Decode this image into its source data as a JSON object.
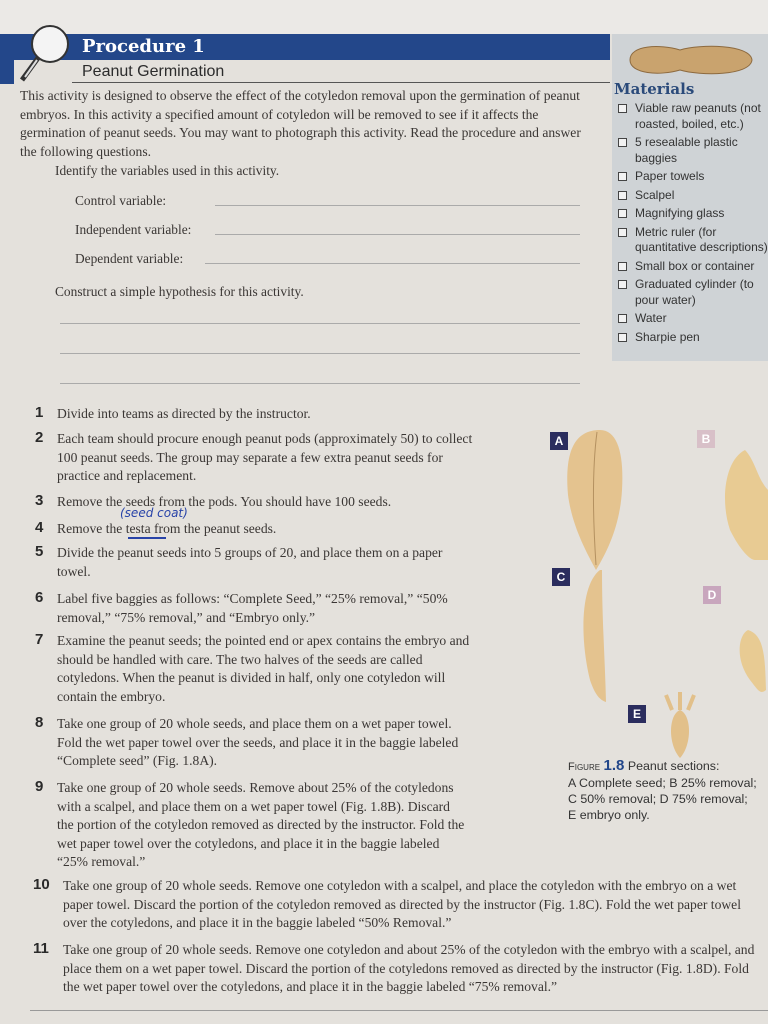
{
  "header": {
    "title": "Procedure 1",
    "subtitle": "Peanut Germination"
  },
  "intro": "This activity is designed to observe the effect of the cotyledon removal upon the germination of peanut embryos. In this activity a specified amount of cotyledon will be removed to see if it affects the germination of peanut seeds. You may want to photograph this activity. Read the procedure and answer the following questions.",
  "questions": {
    "identify": "Identify the variables used in this activity.",
    "control": "Control variable:",
    "independent": "Independent variable:",
    "dependent": "Dependent variable:",
    "hypothesis": "Construct a simple hypothesis for this activity."
  },
  "materials": {
    "title": "Materials",
    "items": [
      "Viable raw peanuts (not roasted, boiled, etc.)",
      "5 resealable plastic baggies",
      "Paper towels",
      "Scalpel",
      "Magnifying glass",
      "Metric ruler (for quantitative descriptions)",
      "Small box or container",
      "Graduated cylinder (to pour water)",
      "Water",
      "Sharpie pen"
    ]
  },
  "steps": [
    {
      "n": "1",
      "text": "Divide into teams as directed by the instructor."
    },
    {
      "n": "2",
      "text": "Each team should procure enough peanut pods (approximately 50) to collect 100 peanut seeds. The group may separate a few extra peanut seeds for practice and replacement."
    },
    {
      "n": "3",
      "text": "Remove the seeds from the pods. You should have 100 seeds."
    },
    {
      "n": "4",
      "text": "Remove the testa from the peanut seeds."
    },
    {
      "n": "5",
      "text": "Divide the peanut seeds into 5 groups of 20, and place them on a paper towel."
    },
    {
      "n": "6",
      "text": "Label five baggies as follows: “Complete Seed,” “25% removal,” “50% removal,” “75% removal,” and “Embryo only.”"
    },
    {
      "n": "7",
      "text": "Examine the peanut seeds; the pointed end or apex contains the embryo and should be handled with care. The two halves of the seeds are called cotyledons. When the peanut is divided in half, only one cotyledon will contain the embryo."
    },
    {
      "n": "8",
      "text": "Take one group of 20 whole seeds, and place them on a wet paper towel. Fold the wet paper towel over the seeds, and place it in the baggie labeled “Complete seed” (Fig. 1.8A)."
    },
    {
      "n": "9",
      "text": "Take one group of 20 whole seeds. Remove about 25% of the cotyledons with a scalpel, and place them on a wet paper towel (Fig. 1.8B). Discard the portion of the cotyledon removed as directed by the instructor. Fold the wet paper towel over the cotyledons, and place it in the baggie labeled “25% removal.”"
    },
    {
      "n": "10",
      "text": "Take one group of 20 whole seeds. Remove one cotyledon with a scalpel, and place the cotyledon with the embryo on a wet paper towel. Discard the portion of the cotyledon removed as directed by the instructor (Fig. 1.8C). Fold the wet paper towel over the cotyledons, and place it in the baggie labeled “50% Removal.”"
    },
    {
      "n": "11",
      "text": "Take one group of 20 whole seeds. Remove one cotyledon and about 25% of the cotyledon with the embryo with a scalpel, and place them on a wet paper towel. Discard the portion of the cotyledons removed as directed by the instructor (Fig. 1.8D). Fold the wet paper towel over the cotyledons, and place it in the baggie labeled “75% removal.”"
    }
  ],
  "handwriting": "(seed coat)",
  "figure": {
    "labels": [
      "A",
      "B",
      "C",
      "D",
      "E"
    ],
    "caption_prefix": "Figure",
    "caption_number": "1.8",
    "caption_title": "Peanut sections:",
    "caption_lines": [
      "A Complete seed; B 25% removal;",
      "C 50% removal; D 75% removal;",
      "E embryo only."
    ]
  },
  "colors": {
    "header_bar": "#23478a",
    "materials_bg": "#cfd3d6",
    "fig_label": "#2b2d5e",
    "handwriting": "#2843a8"
  }
}
